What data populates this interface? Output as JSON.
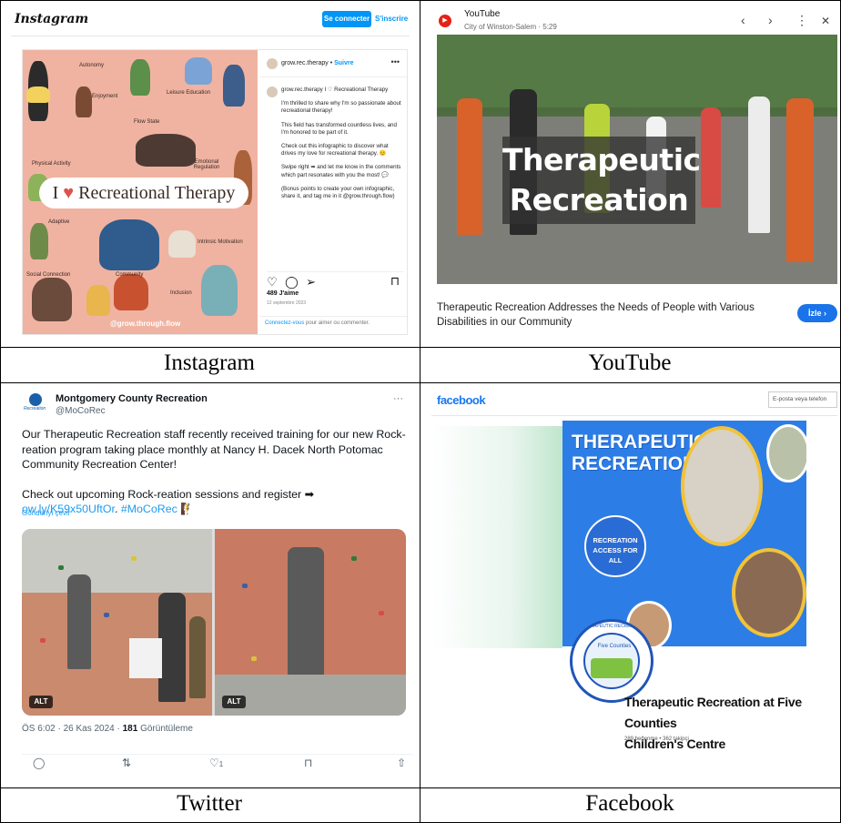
{
  "captions": {
    "instagram": "Instagram",
    "youtube": "YouTube",
    "twitter": "Twitter",
    "facebook": "Facebook"
  },
  "instagram": {
    "logo": "Instagram",
    "connect_label": "Se connecter",
    "signup_label": "S'inscrire",
    "username": "grow.rec.therapy",
    "follow_label": "Suivre",
    "caption_head": "grow.rec.therapy I ♡ Recreational Therapy",
    "caption_paragraphs": [
      "I'm thrilled to share why I'm so passionate about recreational therapy!",
      "This field has transformed countless lives, and I'm honored to be part of it.",
      "Check out this infographic to discover what drives my love for recreational therapy. 😊",
      "Swipe right ➡ and let me know in the comments which part resonates with you the most! 💬",
      "(Bonus points to create your own infographic, share it, and tag me in it @grow.through.flow)"
    ],
    "likes": "489 J'aime",
    "date": "12 septembre 2023",
    "comment_link": "Connectez-vous",
    "comment_rest": " pour aimer ou commenter.",
    "image": {
      "title_pre": "I",
      "title_heart": "♥",
      "title_post": "Recreational Therapy",
      "handle": "@grow.through.flow",
      "labels": [
        "Autonomy",
        "Enjoyment",
        "Leisure Education",
        "Flow State",
        "Physical Activity",
        "Emotional Regulation",
        "Adaptive",
        "Intrinsic Motivation",
        "Social Connection",
        "Community",
        "Inclusion"
      ]
    },
    "colors": {
      "accent": "#0095f6",
      "poster_bg": "#f0b3a2"
    }
  },
  "youtube": {
    "channel": "YouTube",
    "meta": "City of Winston-Salem · 5:29",
    "overlay_line1": "Therapeutic",
    "overlay_line2": "Recreation",
    "title": "Therapeutic Recreation Addresses the Needs of People with Various Disabilities in our Community",
    "watch_label": "İzle ›",
    "nav_prev": "‹",
    "nav_next": "›",
    "nav_more": "⋮",
    "nav_close": "✕",
    "colors": {
      "logo": "#e62117",
      "button": "#1a73e8"
    }
  },
  "twitter": {
    "name": "Montgomery County Recreation",
    "handle": "@MoCoRec",
    "logo_text": "Recreation",
    "more": "···",
    "text1": "Our Therapeutic Recreation staff recently received training for our new Rock-reation program taking place monthly at Nancy H. Dacek North Potomac Community Recreation Center!",
    "text2": "Check out upcoming Rock-reation sessions and register ➡",
    "link": "ow.ly/K59x50UftOr",
    "hashtag": "#MoCoRec",
    "translate": "Gönderiyi çevir",
    "alt_label": "ALT",
    "meta_time": "ÖS 6:02 · 26 Kas 2024 · ",
    "meta_views_num": "181",
    "meta_views_label": " Görüntüleme",
    "likes_count": "1",
    "colors": {
      "link": "#1d9bf0"
    }
  },
  "facebook": {
    "logo": "facebook",
    "search_placeholder": "E-posta veya telefon",
    "banner_title": "THERAPEUTIC RECREATION",
    "badge_text": "RECREATION ACCESS FOR ALL",
    "profile_arc_text": "THERAPEUTIC RECREATION",
    "profile_centre_text": "Five Counties",
    "page_name_line1": "Therapeutic Recreation at Five Counties",
    "page_name_line2": "Children's Centre",
    "stats": "289 beğenme • 362 takipçi",
    "colors": {
      "brand": "#1877f2",
      "banner": "#2d7de6"
    }
  }
}
